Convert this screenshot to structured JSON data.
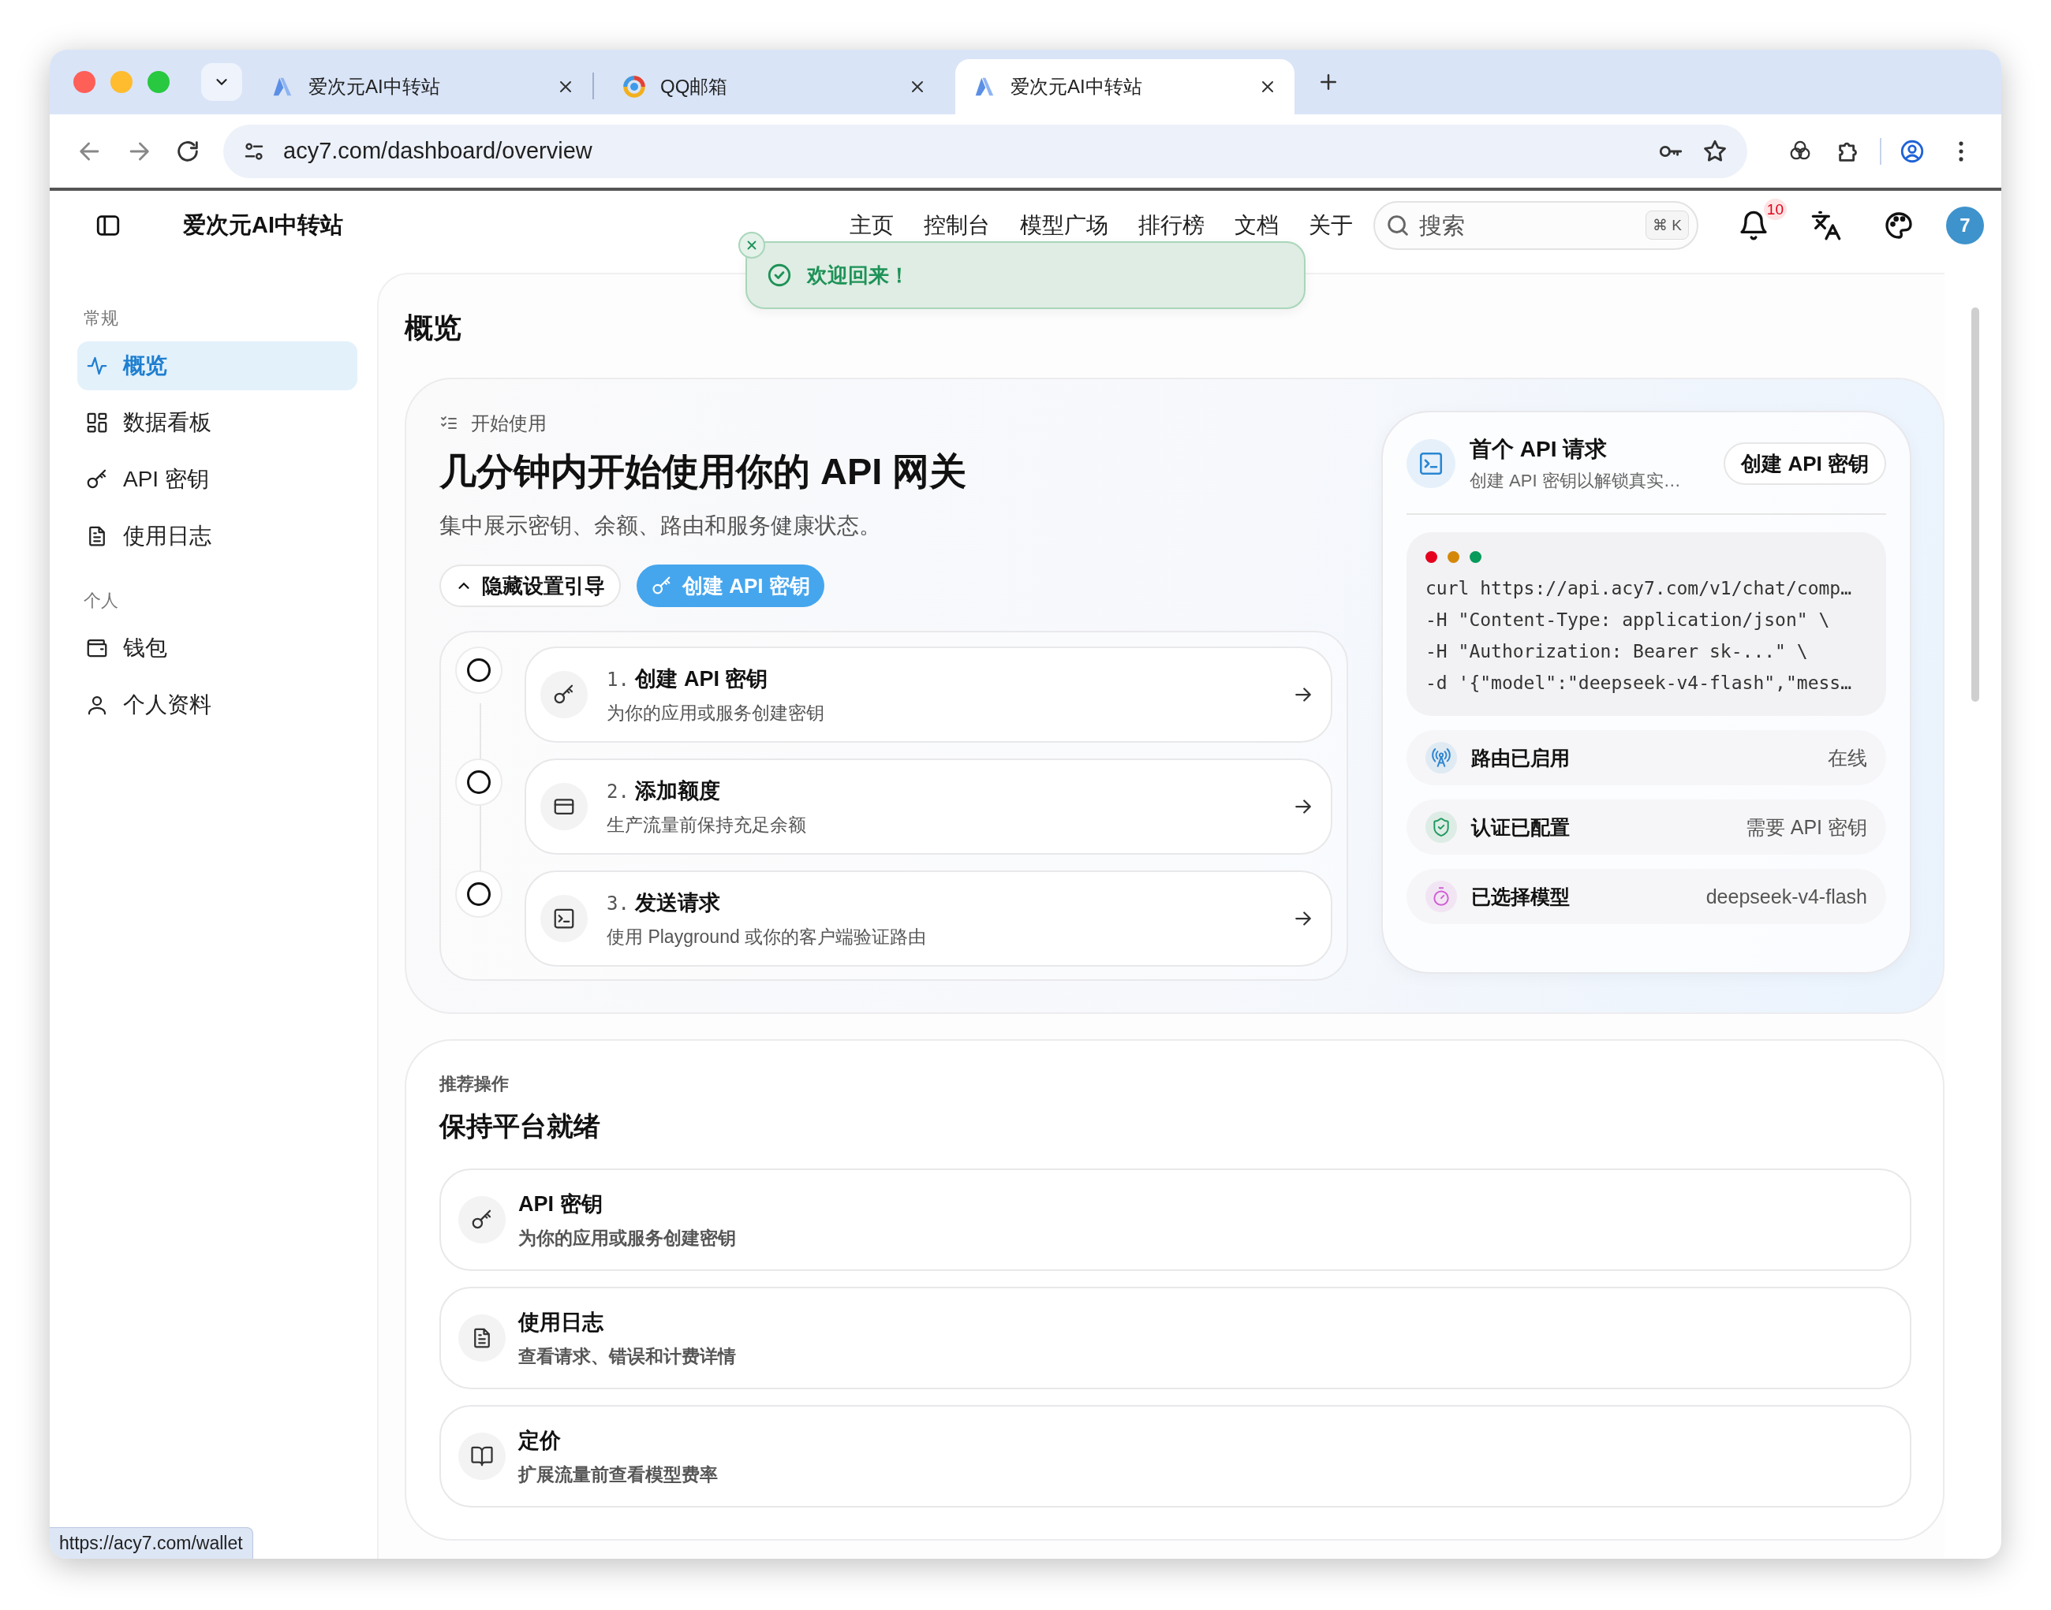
{
  "browser": {
    "tabs": [
      {
        "title": "爱次元AI中转站",
        "kind": "site",
        "selected": false
      },
      {
        "title": "QQ邮箱",
        "kind": "mail",
        "selected": false
      },
      {
        "title": "爱次元AI中转站",
        "kind": "site",
        "selected": true
      }
    ],
    "url": "acy7.com/dashboard/overview",
    "status_url": "https://acy7.com/wallet"
  },
  "header": {
    "site_title": "爱次元AI中转站",
    "nav": [
      "主页",
      "控制台",
      "模型广场",
      "排行榜",
      "文档",
      "关于"
    ],
    "search": {
      "placeholder": "搜索",
      "shortcut": "⌘ K"
    },
    "notification_count": "10",
    "avatar": "7"
  },
  "toast": {
    "message": "欢迎回来！"
  },
  "sidebar": {
    "sections": [
      {
        "label": "常规",
        "items": [
          {
            "label": "概览",
            "kind": "pulse",
            "selected": true
          },
          {
            "label": "数据看板",
            "kind": "grid",
            "selected": false
          },
          {
            "label": "API 密钥",
            "kind": "key",
            "selected": false
          },
          {
            "label": "使用日志",
            "kind": "document",
            "selected": false
          }
        ]
      },
      {
        "label": "个人",
        "items": [
          {
            "label": "钱包",
            "kind": "wallet",
            "selected": false
          },
          {
            "label": "个人资料",
            "kind": "person",
            "selected": false
          }
        ]
      }
    ]
  },
  "page_title": "概览",
  "hero": {
    "eyebrow": "开始使用",
    "title": "几分钟内开始使用你的 API 网关",
    "subtitle": "集中展示密钥、余额、路由和服务健康状态。",
    "buttons": [
      {
        "label": "隐藏设置引导",
        "kind": "secondary"
      },
      {
        "label": "创建 API 密钥",
        "kind": "primary"
      }
    ],
    "steps": [
      {
        "number": "1.",
        "title": "创建 API 密钥",
        "description": "为你的应用或服务创建密钥",
        "kind": "key",
        "done": false
      },
      {
        "number": "2.",
        "title": "添加额度",
        "description": "生产流量前保持充足余额",
        "kind": "card",
        "done": false
      },
      {
        "number": "3.",
        "title": "发送请求",
        "description": "使用 Playground 或你的客户端验证路由",
        "kind": "terminal",
        "done": false
      }
    ]
  },
  "first_request": {
    "title": "首个 API 请求",
    "subtitle": "创建 API 密钥以解锁真实…",
    "button": "创建 API 密钥",
    "code": [
      "curl https://api.acy7.com/v1/chat/comp…",
      "-H \"Content-Type: application/json\" \\",
      "-H \"Authorization: Bearer sk-...\" \\",
      "-d '{\"model\":\"deepseek-v4-flash\",\"mess…"
    ],
    "status": [
      {
        "label": "路由已启用",
        "value": "在线",
        "kind": "antenna",
        "color": "#2f86d1"
      },
      {
        "label": "认证已配置",
        "value": "需要 API 密钥",
        "kind": "shield",
        "color": "#1f9a5e"
      },
      {
        "label": "已选择模型",
        "value": "deepseek-v4-flash",
        "kind": "stopwatch",
        "color": "#d05fd6"
      }
    ]
  },
  "recommended": {
    "eyebrow": "推荐操作",
    "title": "保持平台就绪",
    "items": [
      {
        "title": "API 密钥",
        "description": "为你的应用或服务创建密钥",
        "kind": "key"
      },
      {
        "title": "使用日志",
        "description": "查看请求、错误和计费详情",
        "kind": "document"
      },
      {
        "title": "定价",
        "description": "扩展流量前查看模型费率",
        "kind": "book"
      }
    ]
  }
}
